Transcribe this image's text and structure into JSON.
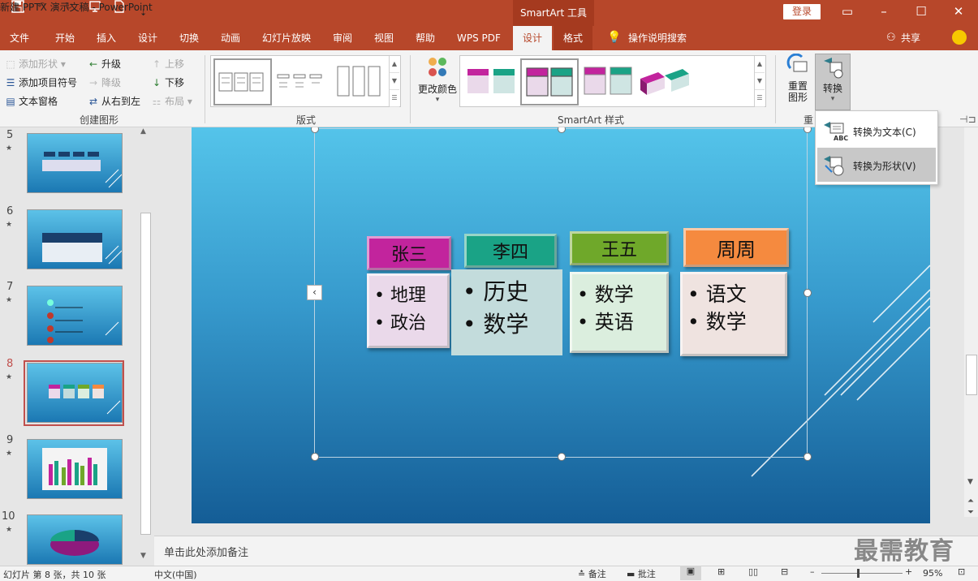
{
  "window": {
    "title": "新建 PPTX 演示文稿 - PowerPoint",
    "context_tools": "SmartArt 工具",
    "login_label": "登录",
    "qat_more": "⇣"
  },
  "tabs": [
    "文件",
    "开始",
    "插入",
    "设计",
    "切换",
    "动画",
    "幻灯片放映",
    "审阅",
    "视图",
    "帮助",
    "WPS PDF",
    "设计",
    "格式"
  ],
  "tell_me": "操作说明搜索",
  "share": "共享",
  "ribbon": {
    "create_graphic": {
      "label": "创建图形",
      "add_shape": "添加形状",
      "add_bullet": "添加项目符号",
      "text_pane": "文本窗格",
      "promote": "升级",
      "demote": "降级",
      "rtl": "从右到左",
      "move_up": "上移",
      "move_down": "下移",
      "layout": "布局"
    },
    "layouts": {
      "label": "版式"
    },
    "styles": {
      "label": "SmartArt 样式",
      "change_colors": "更改颜色"
    },
    "reset": {
      "label": "重",
      "reset_graphic_1": "重置",
      "reset_graphic_2": "图形",
      "convert": "转换"
    }
  },
  "dropdown": {
    "to_text": "转换为文本(C)",
    "to_shapes": "转换为形状(V)",
    "abc": "ABC"
  },
  "thumbnails": [
    {
      "num": "5",
      "star": "★"
    },
    {
      "num": "6",
      "star": "★"
    },
    {
      "num": "7",
      "star": "★"
    },
    {
      "num": "8",
      "star": "★"
    },
    {
      "num": "9",
      "star": "★"
    },
    {
      "num": "10",
      "star": "★"
    }
  ],
  "smartart": {
    "columns": [
      {
        "header": "张三",
        "items": [
          "地理",
          "政治"
        ],
        "header_color": "#c2249d",
        "body_color": "#ead9ea"
      },
      {
        "header": "李四",
        "items": [
          "历史",
          "数学"
        ],
        "header_color": "#1aa386",
        "body_color": "#c3dcdc"
      },
      {
        "header": "王五",
        "items": [
          "数学",
          "英语"
        ],
        "header_color": "#6fa82a",
        "body_color": "#dbeede"
      },
      {
        "header": "周周",
        "items": [
          "语文",
          "数学"
        ],
        "header_color": "#f58a3f",
        "body_color": "#efe3e0"
      }
    ]
  },
  "notes_placeholder": "单击此处添加备注",
  "status": {
    "slide_info": "幻灯片 第 8 张，共 10 张",
    "language": "中文(中国)",
    "notes": "备注",
    "comments": "批注",
    "zoom": "95%"
  },
  "watermark": "最需教育"
}
